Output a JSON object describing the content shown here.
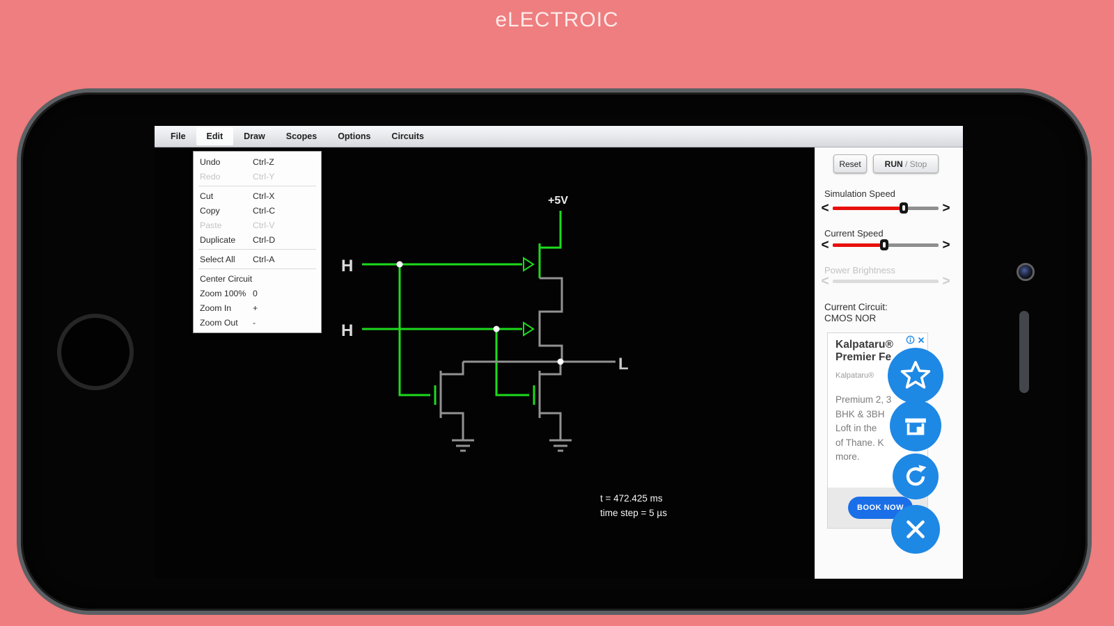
{
  "page": {
    "title": "eLECTROIC"
  },
  "colors": {
    "background": "#ee7e7f",
    "wire_high_green": "#1ddb1d",
    "wire_low_gray": "#929292",
    "slider_red": "#e8100c",
    "fab_blue": "#1e88e5",
    "cta_blue": "#1a6fe8"
  },
  "menu_bar": {
    "items": [
      "File",
      "Edit",
      "Draw",
      "Scopes",
      "Options",
      "Circuits"
    ],
    "active_item": "Edit"
  },
  "edit_menu": {
    "items": [
      {
        "label": "Undo",
        "shortcut": "Ctrl-Z",
        "enabled": true
      },
      {
        "label": "Redo",
        "shortcut": "Ctrl-Y",
        "enabled": false
      },
      {
        "label": "Cut",
        "shortcut": "Ctrl-X",
        "enabled": true
      },
      {
        "label": "Copy",
        "shortcut": "Ctrl-C",
        "enabled": true
      },
      {
        "label": "Paste",
        "shortcut": "Ctrl-V",
        "enabled": false
      },
      {
        "label": "Duplicate",
        "shortcut": "Ctrl-D",
        "enabled": true
      },
      {
        "label": "Select All",
        "shortcut": "Ctrl-A",
        "enabled": true
      },
      {
        "label": "Center Circuit",
        "shortcut": "",
        "enabled": true
      },
      {
        "label": "Zoom 100%",
        "shortcut": "0",
        "enabled": true
      },
      {
        "label": "Zoom In",
        "shortcut": "+",
        "enabled": true
      },
      {
        "label": "Zoom Out",
        "shortcut": "-",
        "enabled": true
      }
    ]
  },
  "sidebar": {
    "reset_button": "Reset",
    "run_button_strong": "RUN",
    "run_button_rest": " / Stop",
    "arrows": {
      "left": "<",
      "right": ">"
    },
    "sliders": [
      {
        "label": "Simulation Speed",
        "enabled": true,
        "position_pct": 67
      },
      {
        "label": "Current Speed",
        "enabled": true,
        "position_pct": 49
      },
      {
        "label": "Power Brightness",
        "enabled": false,
        "position_pct": 0
      }
    ],
    "current_circuit_label": "Current Circuit:",
    "current_circuit_name": "CMOS NOR"
  },
  "ad": {
    "headline_line1": "Kalpataru®",
    "headline_line2": "Premier Fe",
    "attribution": "Kalpataru®",
    "body_lines": [
      "Premium 2, 3",
      "BHK & 3BH",
      "Loft in the",
      "of Thane. K",
      "more."
    ],
    "cta": "BOOK NOW"
  },
  "circuit": {
    "name": "CMOS NOR",
    "vdd_label": "+5V",
    "input_a": "H",
    "input_b": "H",
    "output": "L",
    "time_readout": "t = 472.425 ms",
    "timestep_readout": "time step = 5 µs"
  }
}
